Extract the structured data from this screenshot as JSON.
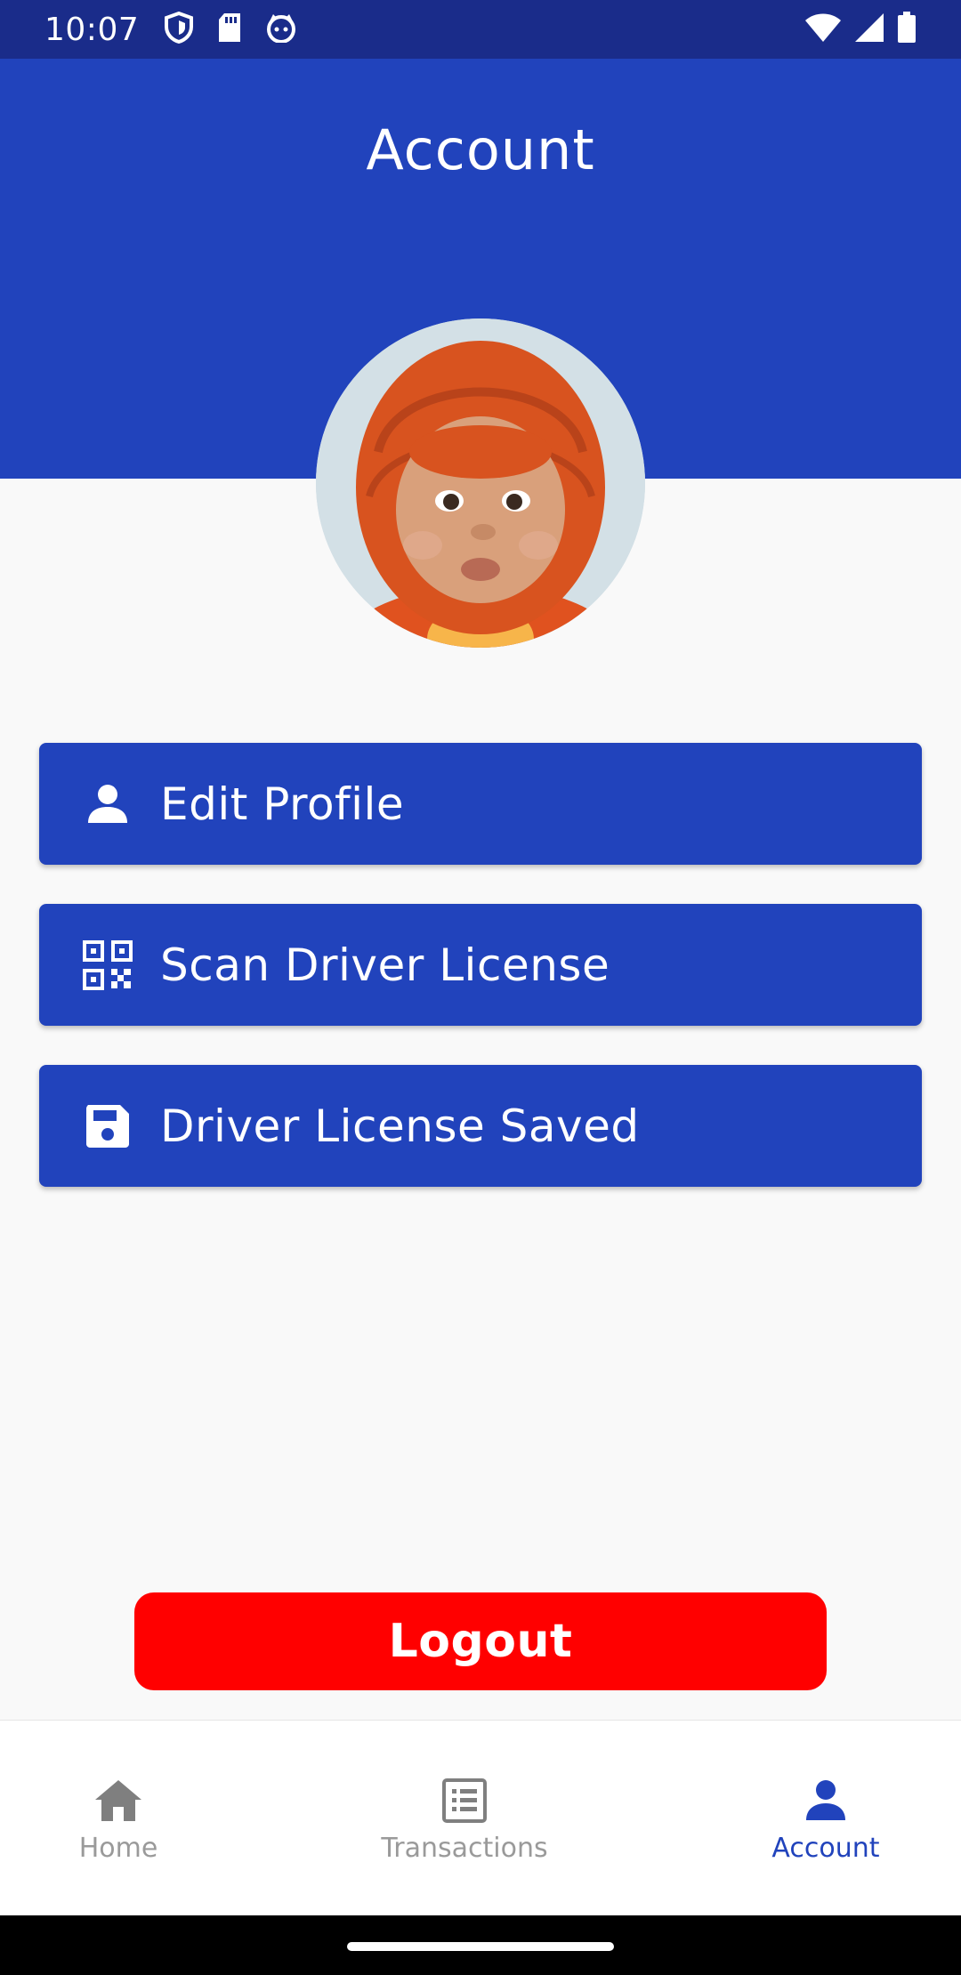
{
  "status_bar": {
    "time": "10:07",
    "left_icons": [
      "shield-icon",
      "sd-card-icon",
      "cat-face-icon"
    ],
    "right_icons": [
      "wifi-icon",
      "signal-icon",
      "battery-icon"
    ]
  },
  "header": {
    "title": "Account",
    "background_color": "#2143bc"
  },
  "profile": {
    "avatar_icon": "profile-photo"
  },
  "menu": {
    "items": [
      {
        "label": "Edit Profile",
        "icon": "person-icon"
      },
      {
        "label": "Scan Driver License",
        "icon": "qr-code-icon"
      },
      {
        "label": "Driver License Saved",
        "icon": "save-icon"
      }
    ]
  },
  "logout": {
    "label": "Logout",
    "color": "#ff0000"
  },
  "bottom_nav": {
    "items": [
      {
        "label": "Home",
        "icon": "home-icon",
        "active": false
      },
      {
        "label": "Transactions",
        "icon": "list-icon",
        "active": false
      },
      {
        "label": "Account",
        "icon": "person-icon",
        "active": true
      }
    ],
    "active_color": "#2143bc",
    "inactive_color": "#9a9a9a"
  }
}
